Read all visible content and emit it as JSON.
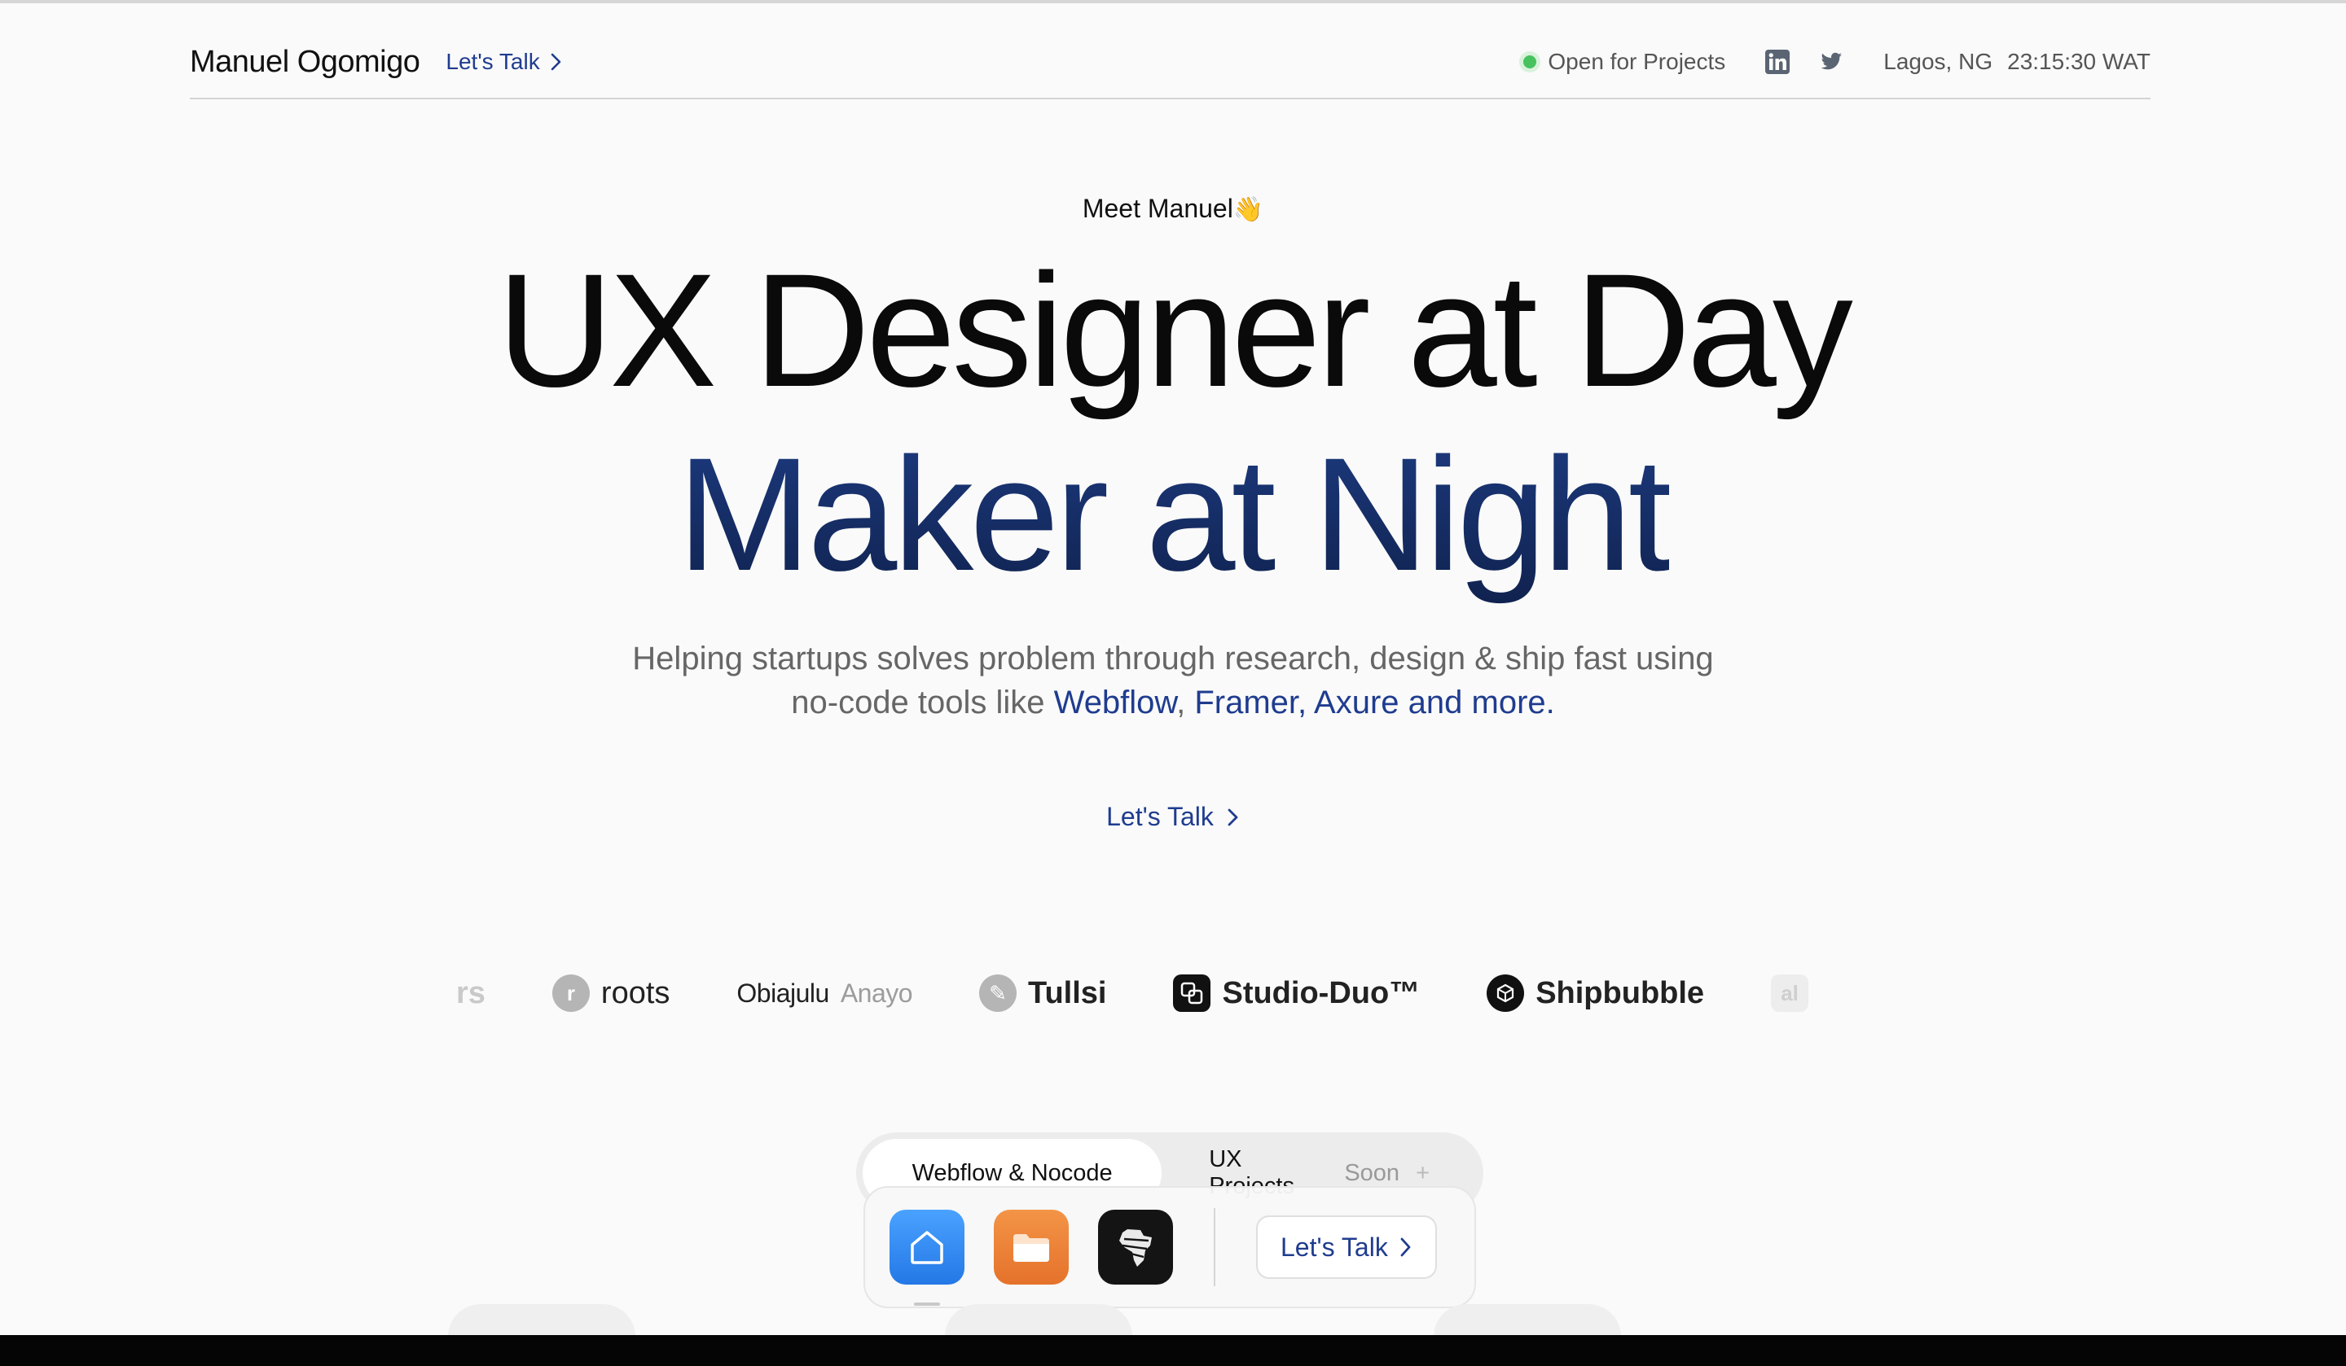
{
  "header": {
    "brand": "Manuel Ogomigo",
    "cta_label": "Let's Talk",
    "status_text": "Open for Projects",
    "location": "Lagos, NG",
    "time": "23:15:30 WAT"
  },
  "hero": {
    "eyebrow": "Meet Manuel",
    "eyebrow_emoji": "👋",
    "headline_line1": "UX Designer at Day",
    "headline_line2": "Maker at Night",
    "sub_part1": "Helping startups solves problem through research, design & ship fast using",
    "sub_part2": "no-code tools like ",
    "sub_link1": "Webflow",
    "sub_comma": ", ",
    "sub_link2": "Framer, Axure and more.",
    "cta_label": "Let's Talk"
  },
  "logos": {
    "items": [
      {
        "name": "rs"
      },
      {
        "name": "roots",
        "mark": "r"
      },
      {
        "first": "Obiajulu",
        "last": "Anayo"
      },
      {
        "name": "Tullsi"
      },
      {
        "name": "Studio-Duo™"
      },
      {
        "name": "Shipbubble"
      },
      {
        "name": "al"
      }
    ]
  },
  "tabs": {
    "active": "Webflow & Nocode",
    "second": "UX Projects",
    "second_badge": "Soon",
    "second_plus": "+"
  },
  "dock": {
    "cta_label": "Let's Talk"
  },
  "colors": {
    "accent": "#1f3c8f",
    "night_blue": "#152e6b",
    "status_green": "#47c25e",
    "background": "#fafafa"
  }
}
